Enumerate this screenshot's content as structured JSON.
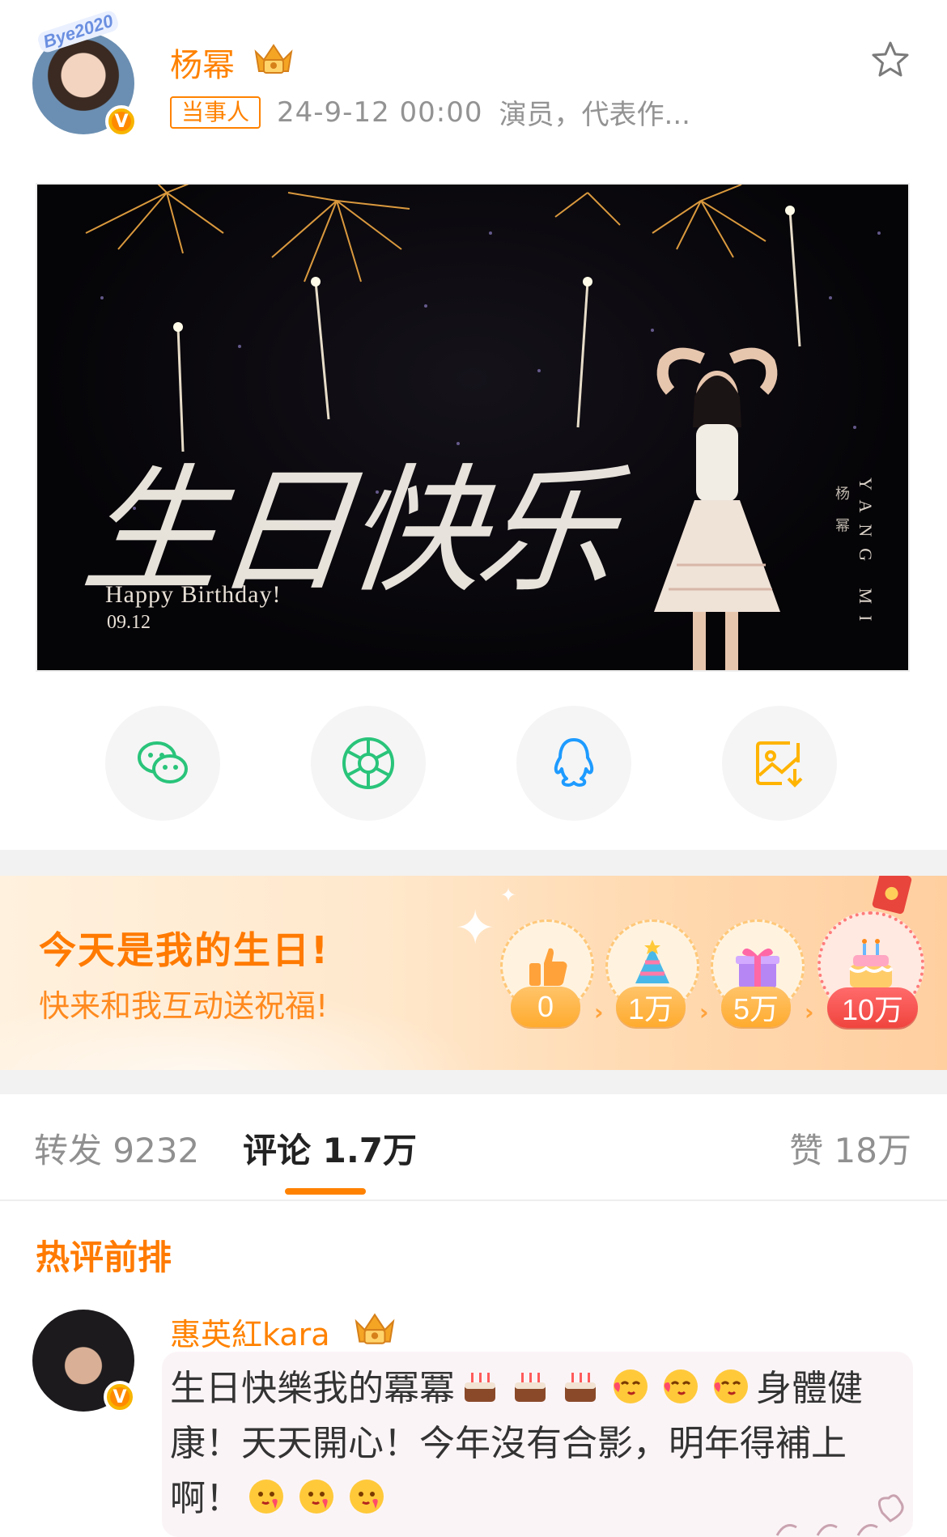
{
  "post": {
    "author": "杨幂",
    "tag": "当事人",
    "time": "24-9-12 00:00",
    "description": "演员，代表作...",
    "avatar_badge": "Bye2020"
  },
  "banner": {
    "title": "生日快乐",
    "subtitle": "Happy Birthday!",
    "date": "09.12",
    "signature": "YANG MI",
    "signature_cn": "杨 幂"
  },
  "share": {
    "icons": [
      "wechat-icon",
      "moments-icon",
      "qq-icon",
      "save-image-icon"
    ]
  },
  "birthday_card": {
    "title": "今天是我的生日!",
    "subtitle": "快来和我互动送祝福!",
    "milestones": [
      "0",
      "1万",
      "5万",
      "10万"
    ]
  },
  "tabs": {
    "repost": "转发 9232",
    "comments": "评论 1.7万",
    "likes": "赞 18万"
  },
  "hot_comments": {
    "title": "热评前排",
    "items": [
      {
        "author": "惠英紅kara",
        "text_part1": "生日快樂我的冪冪",
        "text_part2": "身體健康！天天開心！今年沒有合影，明年得補上啊！"
      }
    ]
  },
  "colors": {
    "brand_orange": "#ff8200",
    "text_gray": "#939393",
    "separator": "#f2f2f2"
  }
}
